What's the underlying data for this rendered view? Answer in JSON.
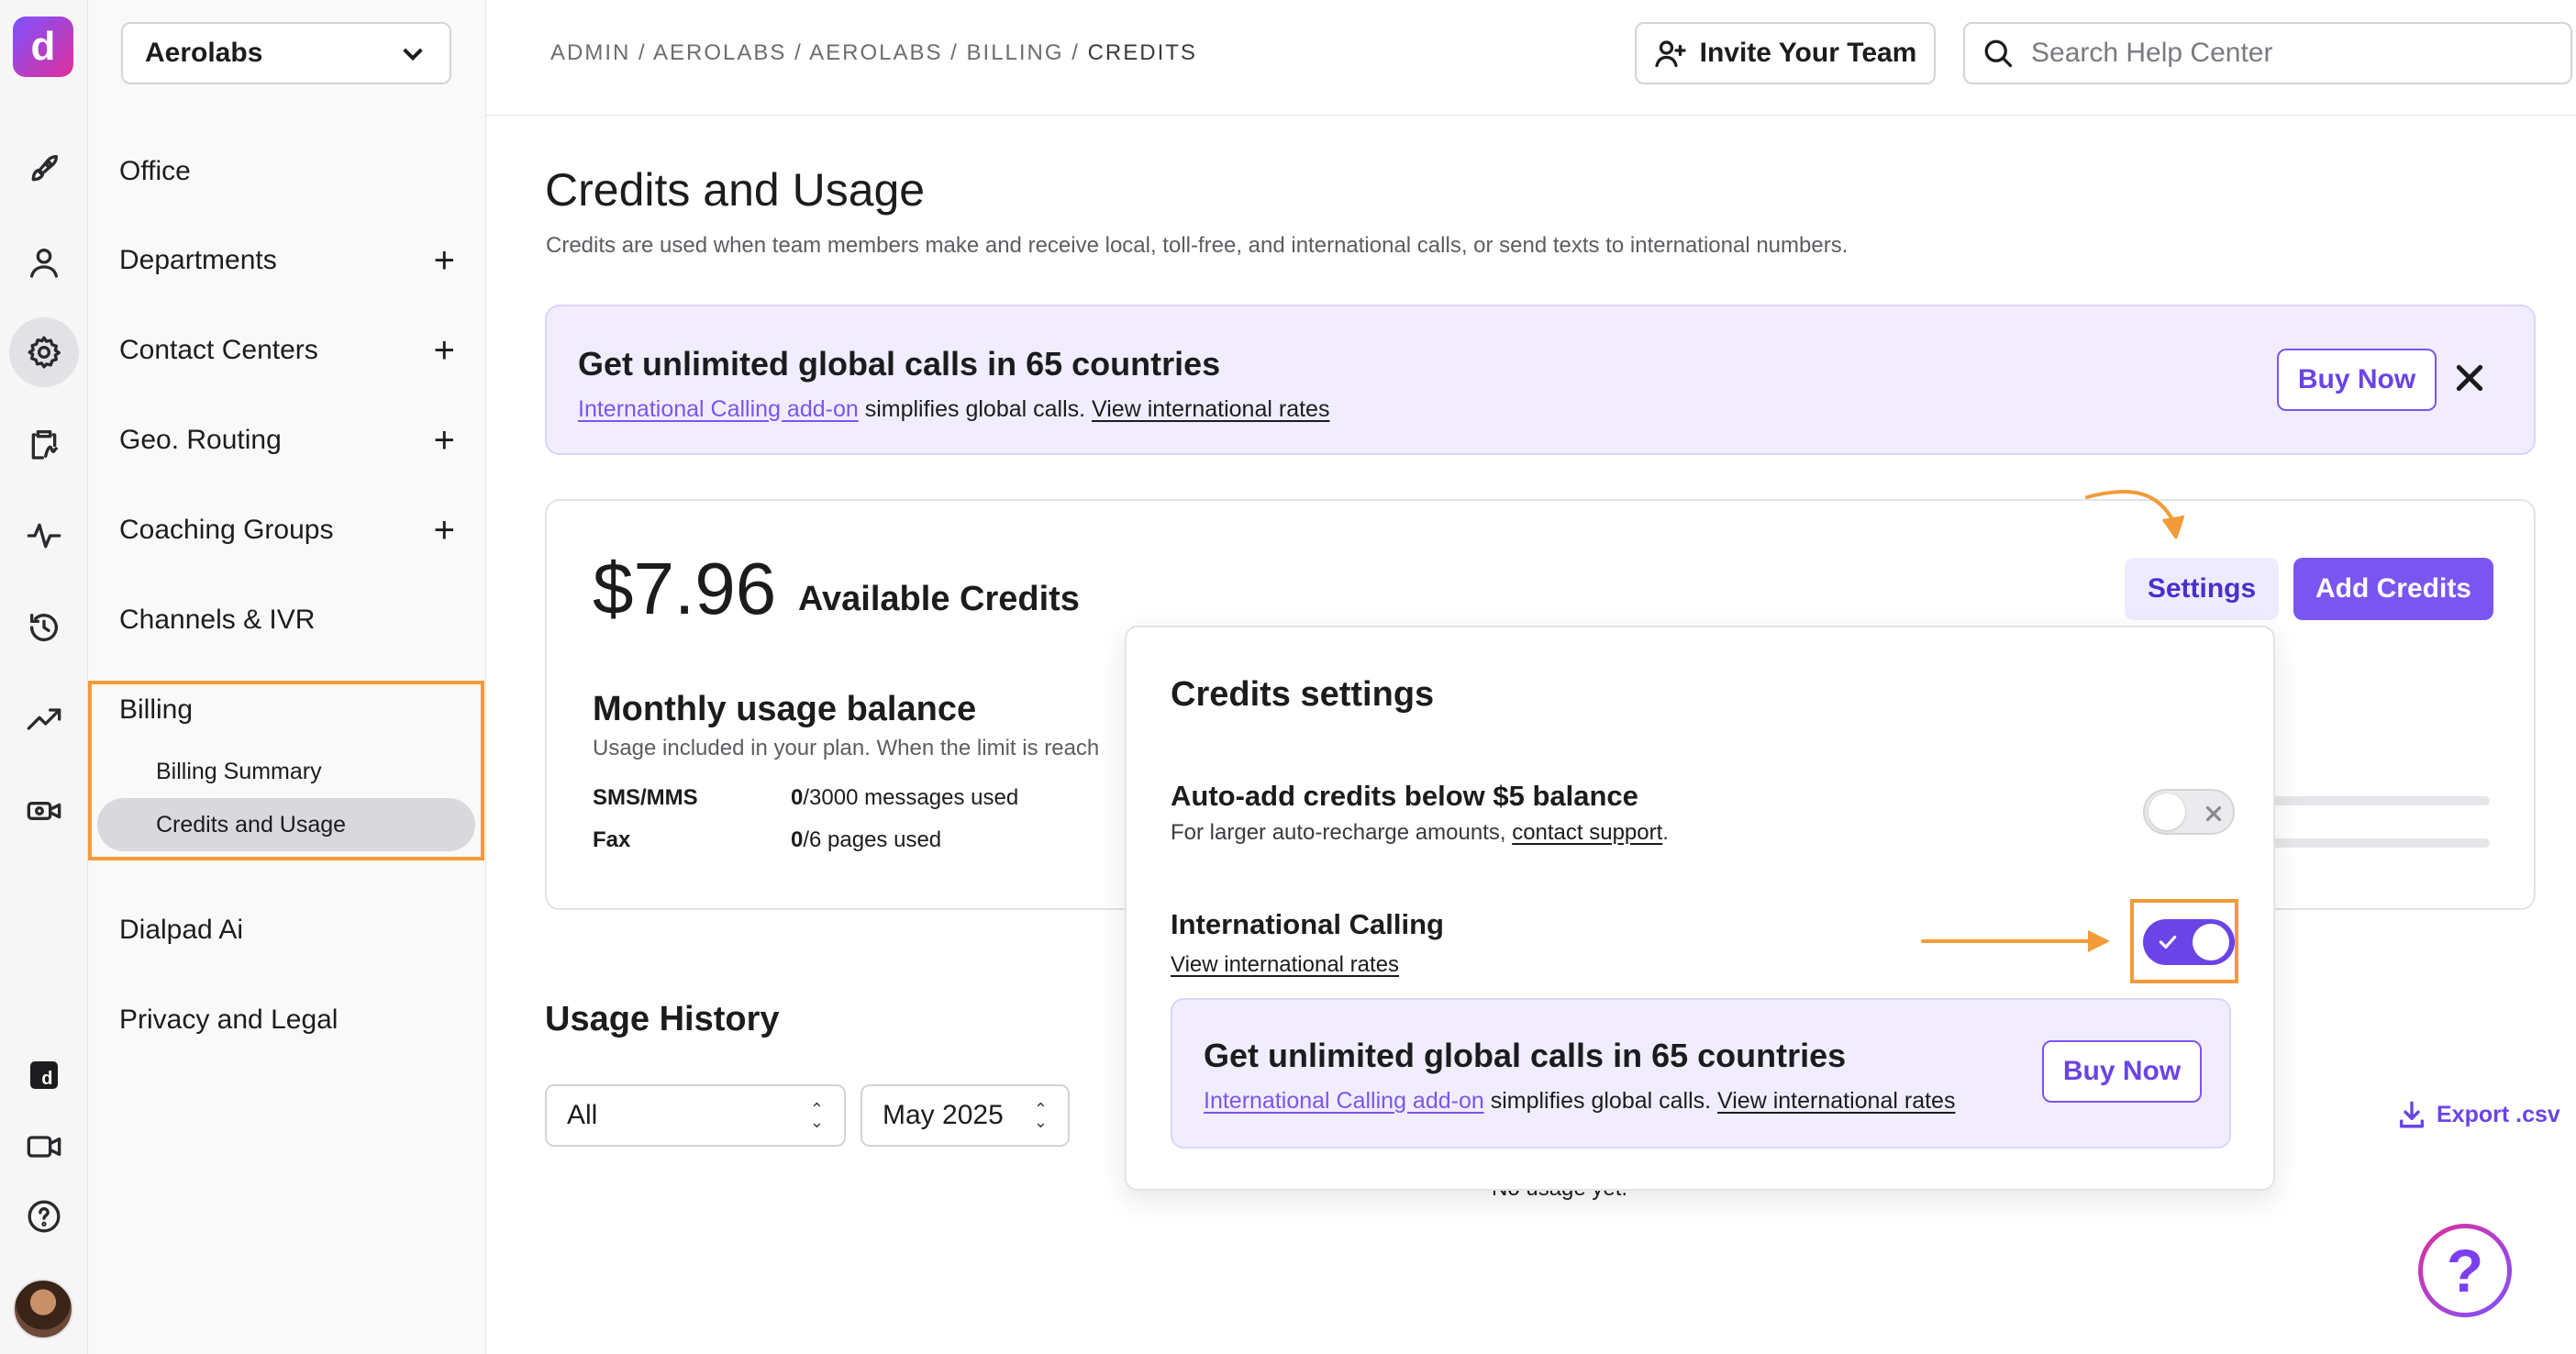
{
  "org_select": {
    "value": "Aerolabs"
  },
  "nav": {
    "items": [
      {
        "label": "Office"
      },
      {
        "label": "Departments"
      },
      {
        "label": "Contact Centers"
      },
      {
        "label": "Geo. Routing"
      },
      {
        "label": "Coaching Groups"
      },
      {
        "label": "Channels & IVR"
      },
      {
        "label": "Billing"
      },
      {
        "label": "Dialpad Ai"
      },
      {
        "label": "Privacy and Legal"
      }
    ],
    "billing_sub": [
      {
        "label": "Billing Summary"
      },
      {
        "label": "Credits and Usage"
      }
    ]
  },
  "header": {
    "breadcrumb": [
      "ADMIN",
      "AEROLABS",
      "AEROLABS",
      "BILLING",
      "CREDITS"
    ],
    "invite_label": "Invite Your Team",
    "search_placeholder": "Search Help Center"
  },
  "main": {
    "title": "Credits and Usage",
    "subtitle": "Credits are used when team members make and receive local, toll-free, and international calls, or send texts to international numbers.",
    "promo": {
      "title": "Get unlimited global calls in 65 countries",
      "link1": "International Calling add-on",
      "text_mid": " simplifies global calls. ",
      "link2": "View international rates",
      "buy_label": "Buy Now"
    },
    "credits": {
      "amount": "$7.96",
      "label": "Available Credits",
      "settings_label": "Settings",
      "add_label": "Add Credits"
    },
    "monthly": {
      "title": "Monthly usage balance",
      "subtitle": "Usage included in your plan. When the limit is reach",
      "rows": [
        {
          "label": "SMS/MMS",
          "used": "0",
          "total": "/3000 messages used"
        },
        {
          "label": "Fax",
          "used": "0",
          "total": "/6 pages used"
        }
      ]
    },
    "history": {
      "title": "Usage History",
      "filter_value": "All",
      "month_value": "May 2025",
      "empty_text": "No usage yet.",
      "export_label": "Export .csv"
    }
  },
  "popover": {
    "title": "Credits settings",
    "auto_add": {
      "title": "Auto-add credits below $5 balance",
      "sub_prefix": "For larger auto-recharge amounts, ",
      "sub_link": "contact support",
      "sub_suffix": ".",
      "enabled": false
    },
    "intl": {
      "title": "International Calling",
      "link": "View international rates",
      "enabled": true
    },
    "promo": {
      "title": "Get unlimited global calls in 65 countries",
      "link1": "International Calling add-on",
      "text_mid": " simplifies global calls. ",
      "link2": "View international rates",
      "buy_label": "Buy Now"
    }
  },
  "help": {
    "glyph": "?"
  },
  "colors": {
    "accent": "#7a55f0",
    "annotation": "#f29b38",
    "promo_bg": "#f1edff"
  },
  "icons": {
    "rail": [
      "rocket-icon",
      "person-icon",
      "gear-icon",
      "clipboard-icon",
      "activity-icon",
      "history-icon",
      "trend-icon",
      "video-settings-icon",
      "dialpad-app-icon",
      "video-icon",
      "help-circle-icon"
    ]
  }
}
